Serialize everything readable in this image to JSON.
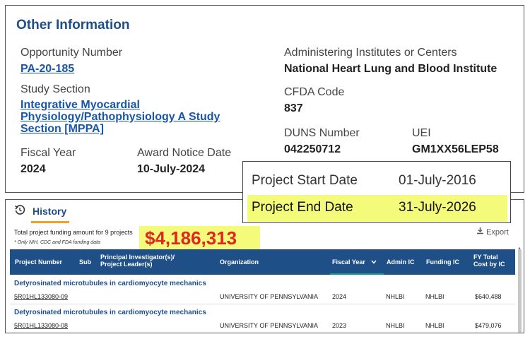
{
  "info": {
    "title": "Other Information",
    "opportunity_label": "Opportunity Number",
    "opportunity_value": "PA-20-185",
    "study_section_label": "Study Section",
    "study_section_line1": "Integrative Myocardial",
    "study_section_line2": "Physiology/Pathophysiology A Study",
    "study_section_line3": "Section [MPPA]",
    "fiscal_year_label": "Fiscal Year",
    "fiscal_year_value": "2024",
    "award_notice_label": "Award Notice Date",
    "award_notice_value": "10-July-2024",
    "administering_label": "Administering Institutes or Centers",
    "administering_value": "National Heart Lung and Blood Institute",
    "cfda_label": "CFDA Code",
    "cfda_value": "837",
    "duns_label": "DUNS Number",
    "duns_value": "042250712",
    "uei_label": "UEI",
    "uei_value": "GM1XX56LEP58"
  },
  "popup": {
    "start_label": "Project Start Date",
    "start_value": "01-July-2016",
    "end_label": "Project End Date",
    "end_value": "31-July-2026",
    "highlight_color": "#f4fb7a"
  },
  "history": {
    "tab_label": "History",
    "total_note": "Total project funding amount for 9 projects",
    "total_amount": "$4,186,313",
    "only_note": "* Only NIH, CDC and FDA funding data",
    "export_label": "Export",
    "columns": {
      "project_number": "Project Number",
      "sub": "Sub",
      "pi_line1": "Principal Investigator(s)/",
      "pi_line2": "Project Leader(s)",
      "organization": "Organization",
      "fiscal_year": "Fiscal Year",
      "admin_ic": "Admin IC",
      "funding_ic": "Funding IC",
      "fy_total_line1": "FY Total",
      "fy_total_line2": "Cost by IC"
    },
    "rows": [
      {
        "title": "Detyrosinated microtubules in cardiomyocyte mechanics",
        "project_number": "5R01HL133080-09",
        "organization": "UNIVERSITY OF PENNSYLVANIA",
        "fiscal_year": "2024",
        "admin_ic": "NHLBI",
        "funding_ic": "NHLBI",
        "cost": "$640,488"
      },
      {
        "title": "Detyrosinated microtubules in cardiomyocyte mechanics",
        "project_number": "5R01HL133080-08",
        "organization": "UNIVERSITY OF PENNSYLVANIA",
        "fiscal_year": "2023",
        "admin_ic": "NHLBI",
        "funding_ic": "NHLBI",
        "cost": "$479,076"
      }
    ]
  },
  "colors": {
    "brand_blue": "#1f4e8c",
    "header_blue": "#1e4f87",
    "amount_red": "#e0271f",
    "tab_orange": "#f0a030"
  }
}
